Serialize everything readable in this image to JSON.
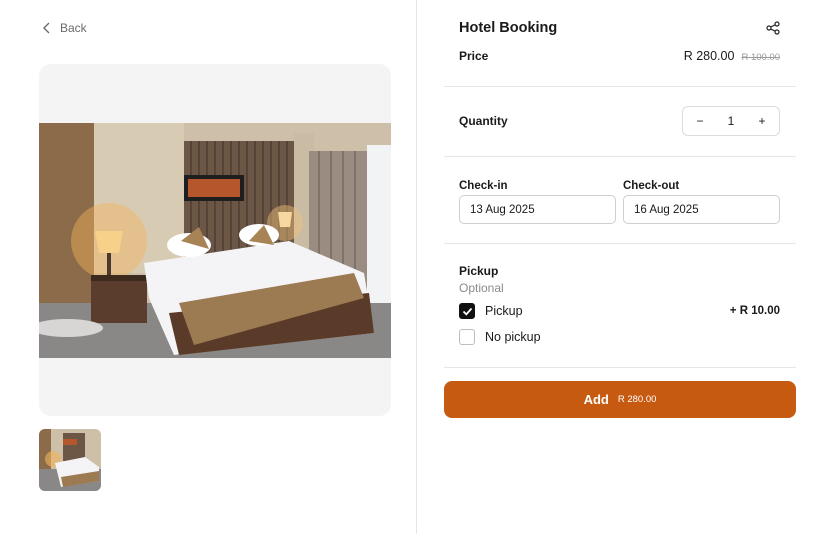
{
  "nav": {
    "back_label": "Back"
  },
  "product": {
    "title": "Hotel Booking",
    "price_label": "Price",
    "price": "R 280.00",
    "original_price": "R 100.00"
  },
  "quantity": {
    "label": "Quantity",
    "value": "1",
    "decrement": "−",
    "increment": "+"
  },
  "dates": {
    "checkin_label": "Check-in",
    "checkin_value": "13 Aug 2025",
    "checkout_label": "Check-out",
    "checkout_value": "16 Aug 2025"
  },
  "pickup": {
    "title": "Pickup",
    "subtitle": "Optional",
    "options": [
      {
        "label": "Pickup",
        "price": "+ R 10.00",
        "checked": true
      },
      {
        "label": "No pickup",
        "price": "",
        "checked": false
      }
    ]
  },
  "cta": {
    "label": "Add",
    "price": "R 280.00",
    "color": "#c65a10"
  },
  "icons": {
    "back": "chevron-left-icon",
    "share": "share-icon",
    "check": "check-icon"
  }
}
